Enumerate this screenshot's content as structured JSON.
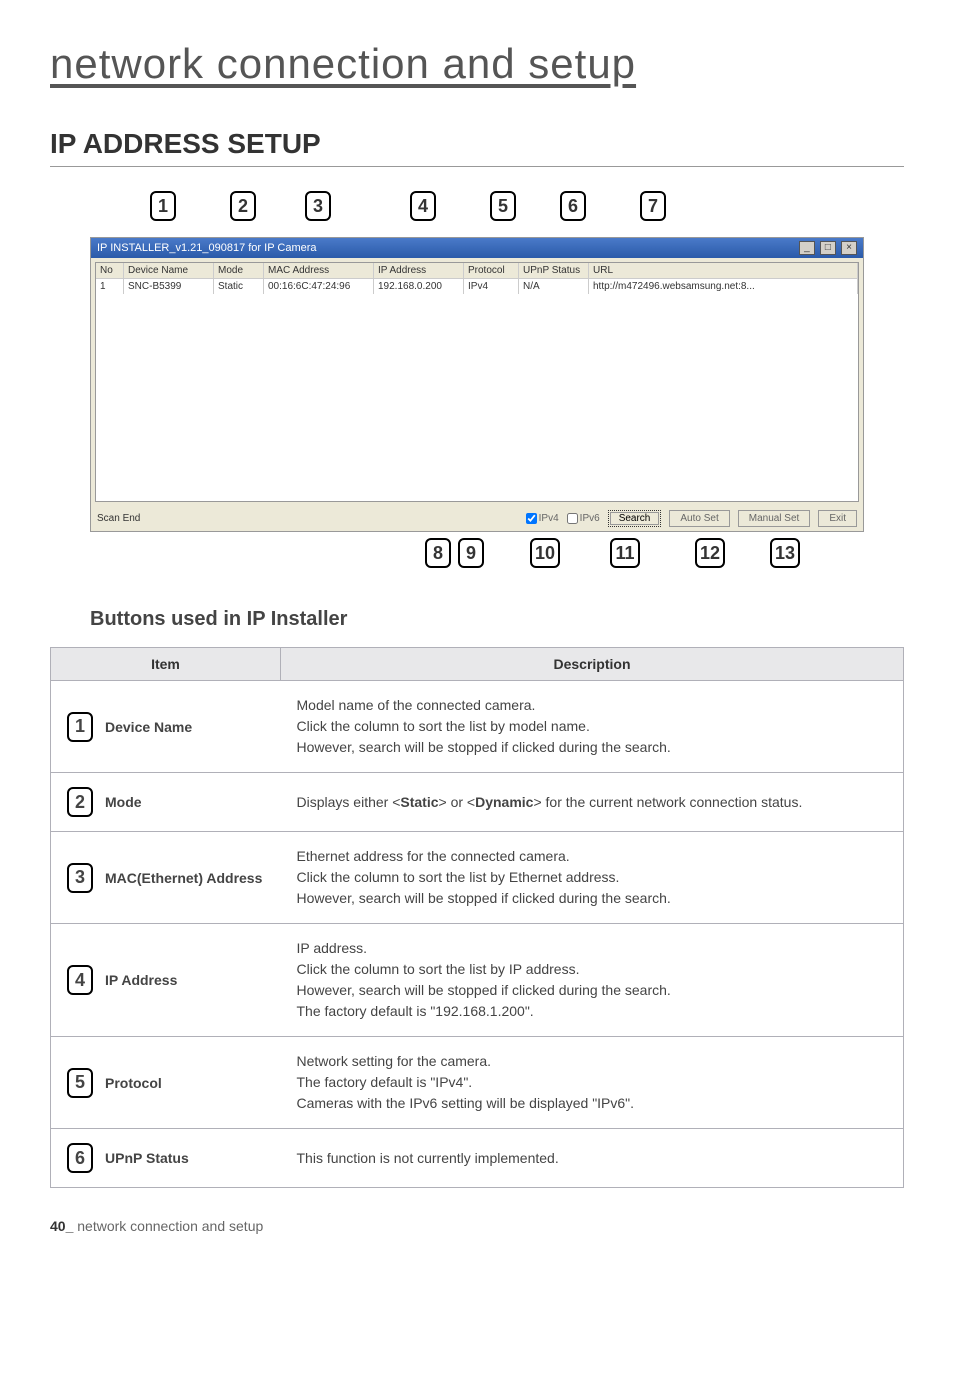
{
  "page_header": "network connection and setup",
  "section_title": "IP ADDRESS SETUP",
  "subhead": "Buttons used in IP Installer",
  "footer_page": "40_",
  "footer_text": "network connection and setup",
  "callouts_top": [
    "1",
    "2",
    "3",
    "4",
    "5",
    "6",
    "7"
  ],
  "callouts_bottom": [
    "8",
    "9",
    "10",
    "11",
    "12",
    "13"
  ],
  "window": {
    "title": "IP INSTALLER_v1.21_090817 for IP Camera",
    "columns": {
      "no": "No",
      "device": "Device Name",
      "mode": "Mode",
      "mac": "MAC Address",
      "ip": "IP Address",
      "proto": "Protocol",
      "upnp": "UPnP Status",
      "url": "URL"
    },
    "row": {
      "no": "1",
      "device": "SNC-B5399",
      "mode": "Static",
      "mac": "00:16:6C:47:24:96",
      "ip": "192.168.0.200",
      "proto": "IPv4",
      "upnp": "N/A",
      "url": "http://m472496.websamsung.net:8..."
    },
    "status": {
      "scan": "Scan End",
      "ipv4": "IPv4",
      "ipv6": "IPv6",
      "search": "Search",
      "autoset": "Auto Set",
      "manualset": "Manual Set",
      "exit": "Exit"
    }
  },
  "table": {
    "head_item": "Item",
    "head_desc": "Description",
    "rows": [
      {
        "num": "1",
        "label": "Device Name",
        "desc": "Model name of the connected camera.\nClick the column to sort the list by model name.\nHowever, search will be stopped if clicked during the search."
      },
      {
        "num": "2",
        "label": "Mode",
        "desc": "Displays either <Static> or <Dynamic> for the current network connection status."
      },
      {
        "num": "3",
        "label": "MAC(Ethernet) Address",
        "desc": "Ethernet address for the connected camera.\nClick the column to sort the list by Ethernet address.\nHowever, search will be stopped if clicked during the search."
      },
      {
        "num": "4",
        "label": "IP Address",
        "desc": "IP address.\nClick the column to sort the list by IP address.\nHowever, search will be stopped if clicked during the search.\nThe factory default is \"192.168.1.200\"."
      },
      {
        "num": "5",
        "label": "Protocol",
        "desc": "Network setting for the camera.\nThe factory default is \"IPv4\".\nCameras with the IPv6 setting will be displayed \"IPv6\"."
      },
      {
        "num": "6",
        "label": "UPnP Status",
        "desc": "This function is not currently implemented."
      }
    ]
  }
}
